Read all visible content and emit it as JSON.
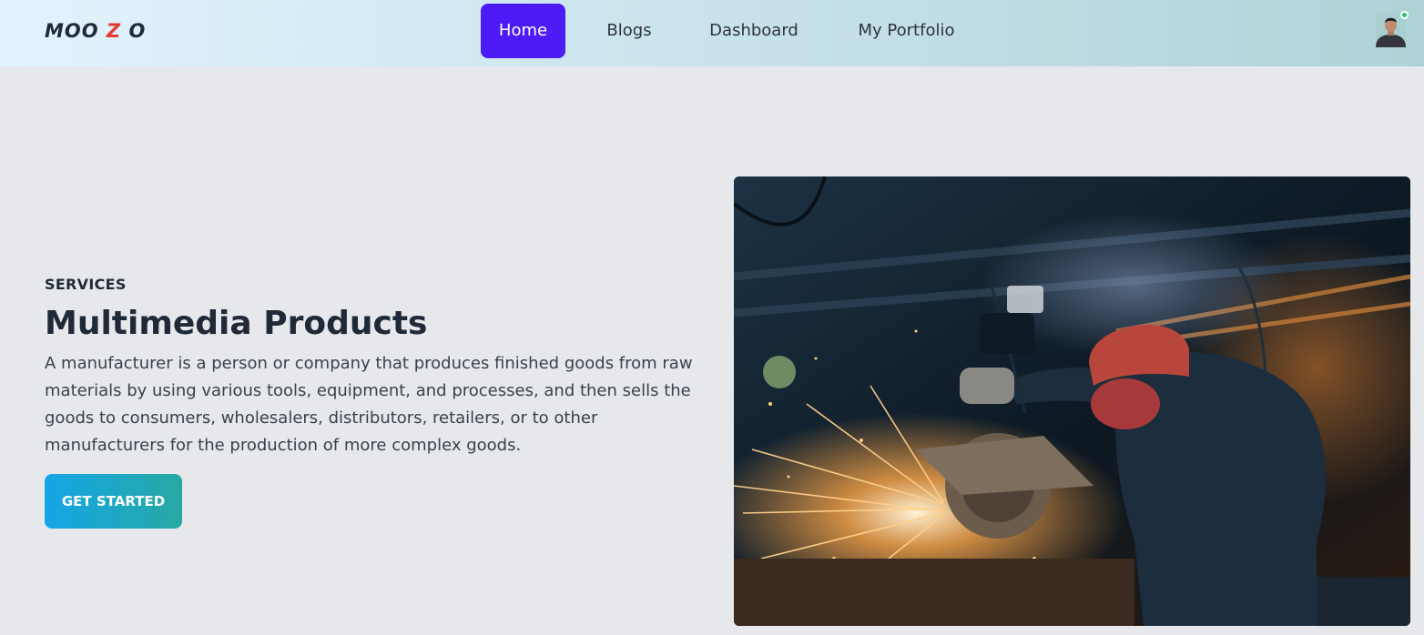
{
  "brand": {
    "part1": "MOO ",
    "accent": "Z",
    "part2": " O"
  },
  "nav": {
    "items": [
      "Home",
      "Blogs",
      "Dashboard",
      "My Portfolio"
    ],
    "active": "Home"
  },
  "user": {
    "avatar_icon": "user-avatar",
    "status": "online"
  },
  "hero": {
    "eyebrow": "SERVICES",
    "title": "Multimedia Products",
    "description": "A manufacturer is a person or company that produces finished goods from raw materials by using various tools, equipment, and processes, and then sells the goods to consumers, wholesalers, distributors, retailers, or to other manufacturers for the production of more complex goods.",
    "cta_label": "GET STARTED",
    "image": "worker-angle-grinder-sparks-photo"
  },
  "colors": {
    "nav_active": "#4c1bf6",
    "accent_red": "#e53935",
    "cta_start": "#14a5e8",
    "cta_end": "#27a9a1",
    "status_online": "#23c26b"
  }
}
